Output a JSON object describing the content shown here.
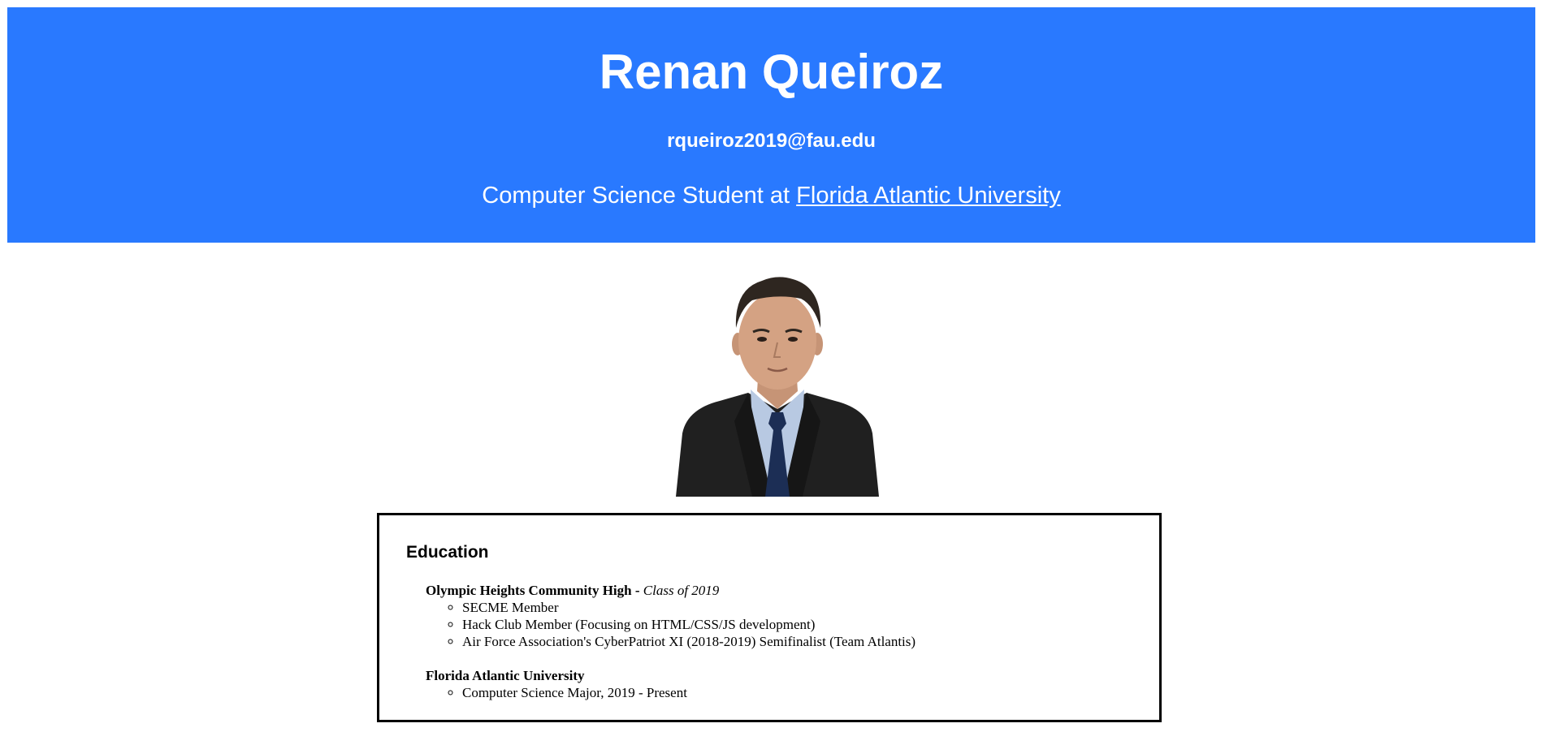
{
  "header": {
    "name": "Renan Queiroz",
    "email": "rqueiroz2019@fau.edu",
    "tagline_prefix": "Computer Science Student at ",
    "university_link": "Florida Atlantic University",
    "background_color": "#2979ff"
  },
  "profile_photo": {
    "alt": "Renan Queiroz"
  },
  "education": {
    "title": "Education",
    "schools": [
      {
        "name": "Olympic Heights Community High",
        "separator": " - ",
        "detail": "Class of 2019",
        "items": [
          "SECME Member",
          "Hack Club Member (Focusing on HTML/CSS/JS development)",
          "Air Force Association's CyberPatriot XI (2018-2019) Semifinalist (Team Atlantis)"
        ]
      },
      {
        "name": "Florida Atlantic University",
        "items": [
          "Computer Science Major, 2019 - Present"
        ]
      }
    ]
  }
}
